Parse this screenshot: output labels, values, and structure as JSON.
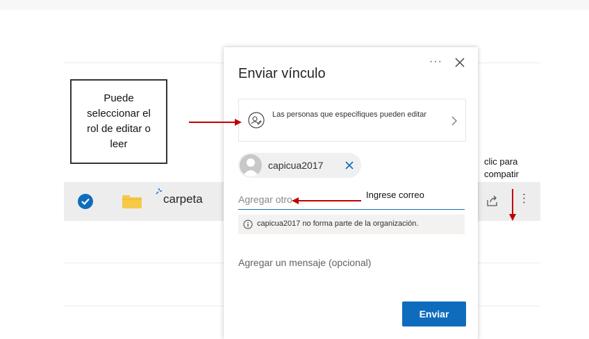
{
  "background_file": {
    "name": "carpeta",
    "selected": true
  },
  "dialog": {
    "title": "Enviar vínculo",
    "more_label": "···",
    "permission_text": "Las personas que especifiques pueden editar",
    "recipient_chip": "capicua2017",
    "email_placeholder": "Agregar otro",
    "info_message": "capicua2017 no forma parte de la organización.",
    "message_placeholder": "Agregar un mensaje (opcional)",
    "send_label": "Enviar"
  },
  "annotations": {
    "callout_text": "Puede seleccionar el rol de editar o leer",
    "email_note": "Ingrese correo",
    "share_note": "clic para compatir",
    "arrow_color": "#c00000"
  },
  "colors": {
    "accent": "#0f6cbd",
    "folder": "#f7c948"
  }
}
